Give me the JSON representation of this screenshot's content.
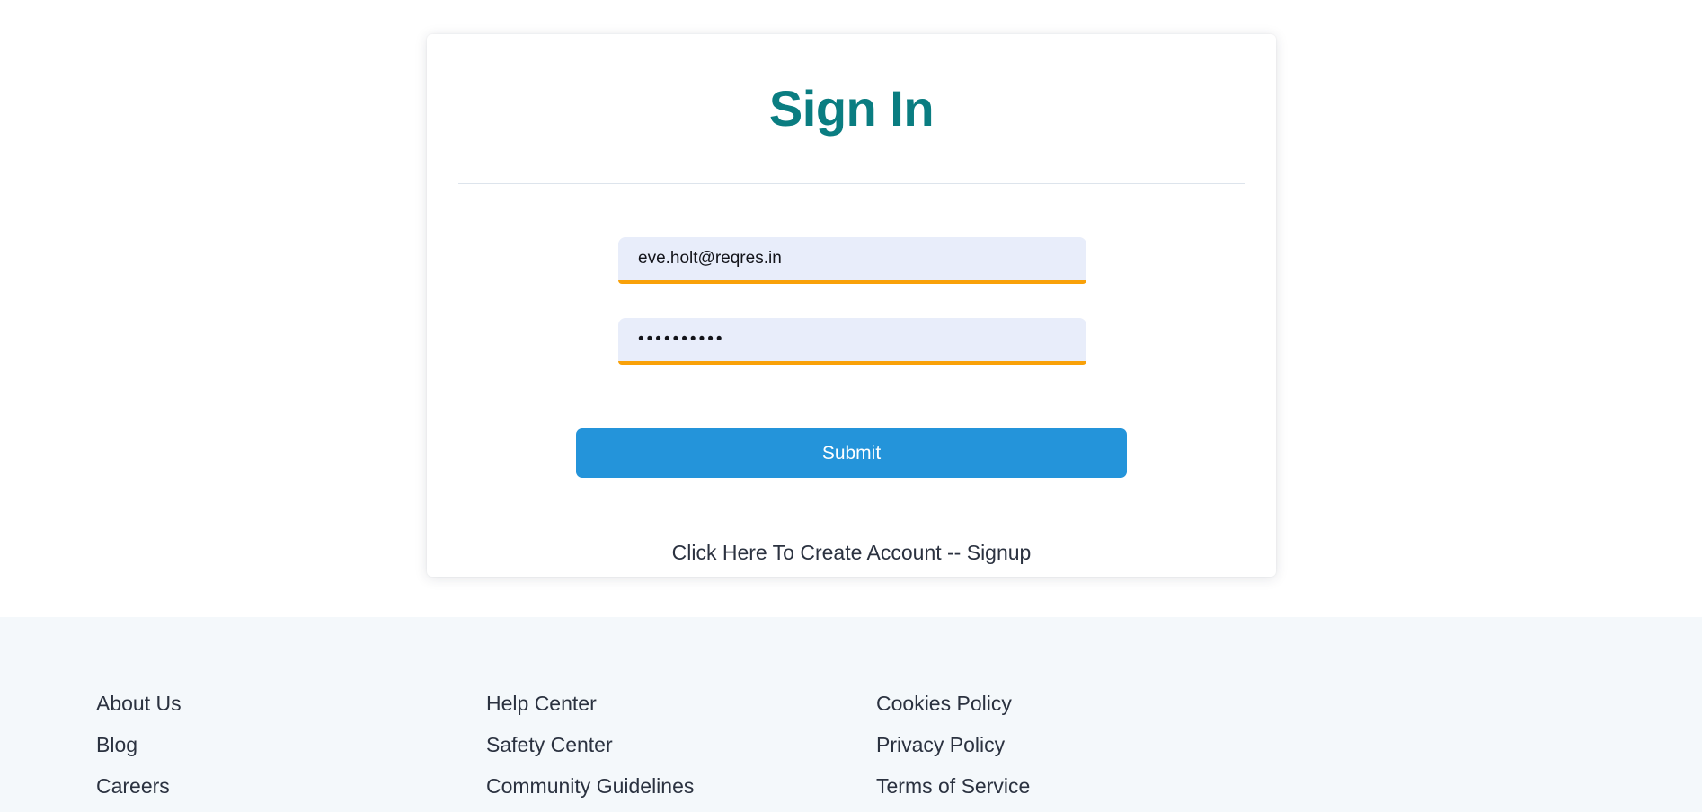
{
  "auth_card": {
    "title": "Sign In",
    "email_field": {
      "value": "eve.holt@reqres.in",
      "placeholder": "Email"
    },
    "password_field": {
      "value": "••••••••••",
      "placeholder": "Password"
    },
    "submit_label": "Submit",
    "signup_link": "Click Here To Create Account -- Signup"
  },
  "footer": {
    "columns": [
      {
        "links": [
          {
            "label": "About Us"
          },
          {
            "label": "Blog"
          },
          {
            "label": "Careers"
          }
        ]
      },
      {
        "links": [
          {
            "label": "Help Center"
          },
          {
            "label": "Safety Center"
          },
          {
            "label": "Community Guidelines"
          }
        ]
      },
      {
        "links": [
          {
            "label": "Cookies Policy"
          },
          {
            "label": "Privacy Policy"
          },
          {
            "label": "Terms of Service"
          }
        ]
      }
    ]
  },
  "colors": {
    "title_teal": "#0a7d81",
    "submit_blue": "#2494da",
    "field_background": "#e8edfa",
    "field_underline_orange": "#f9a109",
    "footer_background": "#f4f8fb",
    "text_dark": "#2b3240",
    "divider": "#dde4ec"
  }
}
